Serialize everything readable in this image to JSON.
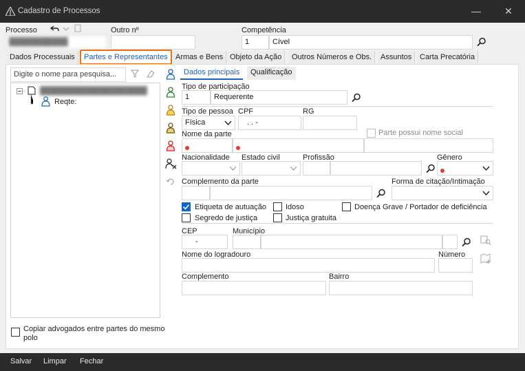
{
  "window": {
    "title": "Cadastro de Processos",
    "minimize": "—",
    "close": "✕"
  },
  "header": {
    "processo_label": "Processo",
    "outro_label": "Outro nº",
    "competencia_label": "Competência",
    "competencia_code": "1",
    "competencia_value": "Cível"
  },
  "tabs": [
    {
      "label": "Dados Processuais"
    },
    {
      "label": "Partes e Representantes"
    },
    {
      "label": "Armas e Bens"
    },
    {
      "label": "Objeto da Ação"
    },
    {
      "label": "Outros Números e Obs."
    },
    {
      "label": "Assuntos"
    },
    {
      "label": "Carta Precatória"
    }
  ],
  "left": {
    "search_placeholder": "Digite o nome para pesquisa...",
    "tree_child_label": "Reqte:",
    "copy_label": "Copiar advogados entre partes do mesmo polo"
  },
  "subtabs": {
    "principal": "Dados principais",
    "qualificacao": "Qualificação"
  },
  "form": {
    "tipo_participacao_label": "Tipo de participação",
    "tipo_participacao_code": "1",
    "tipo_participacao_value": "Requerente",
    "tipo_pessoa_label": "Tipo de pessoa",
    "tipo_pessoa_value": "Física",
    "cpf_label": "CPF",
    "cpf_value": ". . -",
    "rg_label": "RG",
    "nome_social_label": "Parte possui nome social",
    "nome_parte_label": "Nome da parte",
    "nacionalidade_label": "Nacionalidade",
    "estado_civil_label": "Estado civil",
    "profissao_label": "Profissão",
    "genero_label": "Gênero",
    "complemento_parte_label": "Complemento da parte",
    "forma_citacao_label": "Forma de citação/Intimação",
    "checks": {
      "etiqueta": "Etiqueta de autuação",
      "idoso": "Idoso",
      "doenca": "Doença Grave / Portador de deficiência",
      "segredo": "Segredo de justiça",
      "justica_gratuita": "Justiça gratuita"
    },
    "cep_label": "CEP",
    "cep_value": "-",
    "municipio_label": "Município",
    "logradouro_label": "Nome do logradouro",
    "numero_label": "Número",
    "complemento_label": "Complemento",
    "bairro_label": "Bairro"
  },
  "footer": {
    "salvar": "Salvar",
    "limpar": "Limpar",
    "fechar": "Fechar"
  },
  "colors": {
    "accent_orange": "#e7731b",
    "link_blue": "#1f5fb5",
    "check_blue": "#1565c0",
    "required_red": "#e53935",
    "title_bg": "#2b2b2b"
  }
}
